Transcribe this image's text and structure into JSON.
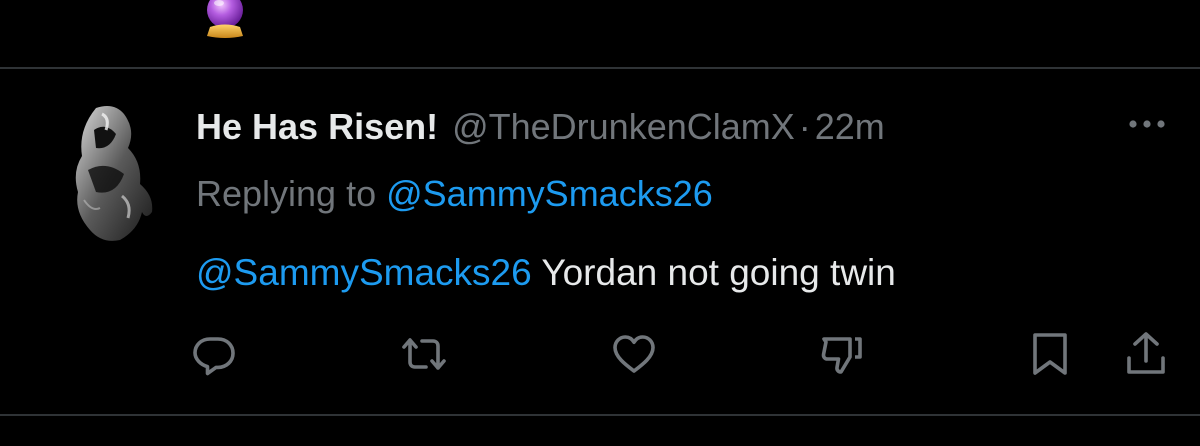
{
  "previous_tweet": {
    "emoji_icon": "crystal-ball-icon"
  },
  "tweet": {
    "display_name": "He Has Risen!",
    "handle": "@TheDrunkenClamX",
    "separator": "·",
    "time": "22m",
    "replying_to_label": "Replying to",
    "replying_to_handle": "@SammySmacks26",
    "text_mention": "@SammySmacks26",
    "text_body": " Yordan not going twin"
  },
  "actions": [
    {
      "name": "reply",
      "icon": "reply-icon"
    },
    {
      "name": "retweet",
      "icon": "retweet-icon"
    },
    {
      "name": "like",
      "icon": "heart-icon"
    },
    {
      "name": "dislike",
      "icon": "thumbs-down-icon"
    },
    {
      "name": "bookmark",
      "icon": "bookmark-icon"
    },
    {
      "name": "share",
      "icon": "share-icon"
    }
  ],
  "colors": {
    "background": "#000000",
    "primary_text": "#e7e9ea",
    "secondary_text": "#71767b",
    "link": "#1d9bf0",
    "divider": "#2f3336"
  }
}
